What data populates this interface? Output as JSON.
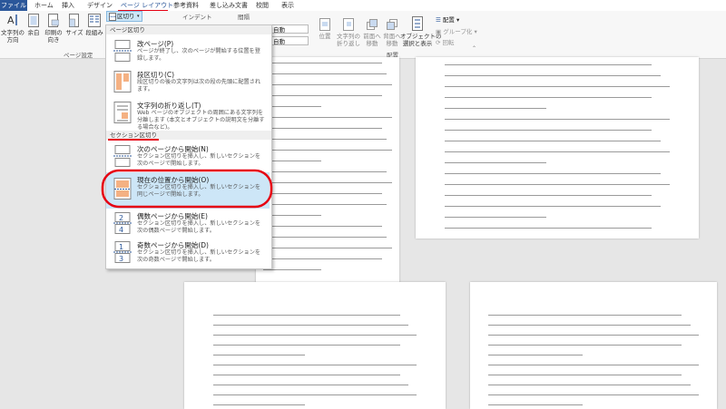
{
  "ribbon": {
    "tabs": [
      "ファイル",
      "ホーム",
      "挿入",
      "デザイン",
      "ページ レイアウト",
      "参考資料",
      "差し込み文書",
      "校閲",
      "表示"
    ],
    "buttons": {
      "text_direction": "文字列の\n方向",
      "margins": "余白",
      "orientation": "印刷の\n向き",
      "size": "サイズ",
      "columns": "段組み",
      "breaks": "区切り",
      "indent": "インデント",
      "spacing": "間隔",
      "position": "位置",
      "wrap_text": "文字列の\n折り返し",
      "bring_forward": "前面へ\n移動",
      "send_backward": "背面へ\n移動",
      "selection_pane": "オブジェクトの\n選択と表示",
      "align": "配置",
      "group": "グループ化",
      "rotate": "回転"
    },
    "spin_auto_1": "自動",
    "spin_auto_2": "自動",
    "group_labels": {
      "page_setup": "ページ設定",
      "arrange": "配置"
    }
  },
  "menu": {
    "header_page": "ページ区切り",
    "header_section": "セクション区切り",
    "items": [
      {
        "title": "改ページ(P)",
        "desc": "ページが終了し、次のページが開始する位置を登録します。"
      },
      {
        "title": "段区切り(C)",
        "desc": "段区切りの後の文字列は次の段の先頭に配置されます。"
      },
      {
        "title": "文字列の折り返し(T)",
        "desc": "Web ページのオブジェクトの周囲にある文字列を分離します (本文とオブジェクトの説明文を分離する場合など)。"
      },
      {
        "title": "次のページから開始(N)",
        "desc": "セクション区切りを挿入し、新しいセクションを次のページで開始します。"
      },
      {
        "title": "現在の位置から開始(O)",
        "desc": "セクション区切りを挿入し、新しいセクションを同じページで開始します。"
      },
      {
        "title": "偶数ページから開始(E)",
        "desc": "セクション区切りを挿入し、新しいセクションを次の偶数ページで開始します。"
      },
      {
        "title": "奇数ページから開始(D)",
        "desc": "セクション区切りを挿入し、新しいセクションを次の奇数ページで開始します。"
      }
    ]
  },
  "colors": {
    "accent": "#2b579a",
    "highlight": "#e60012",
    "selected_bg": "#cde6f7"
  }
}
